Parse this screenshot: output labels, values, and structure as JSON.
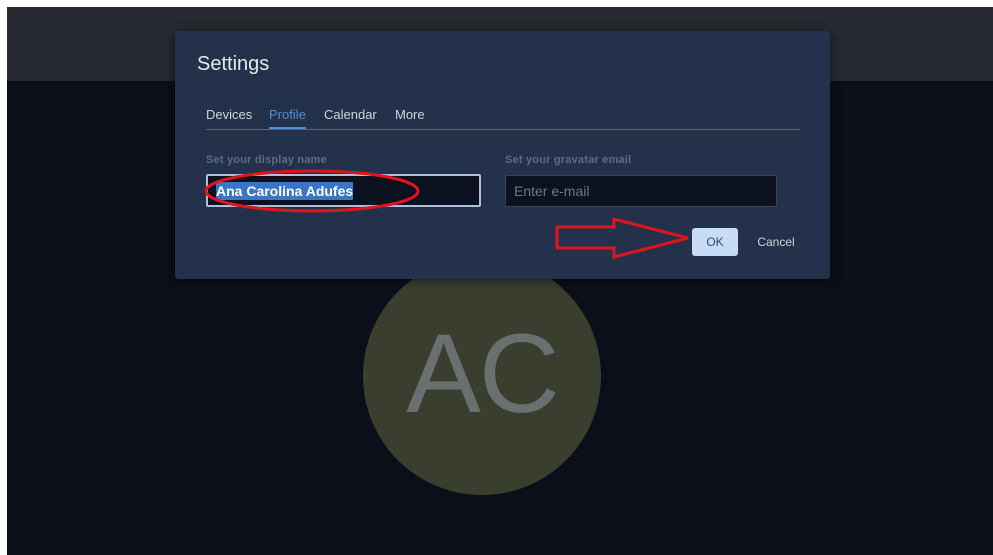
{
  "avatar": {
    "initials": "AC"
  },
  "dialog": {
    "title": "Settings",
    "tabs": [
      {
        "label": "Devices",
        "active": false
      },
      {
        "label": "Profile",
        "active": true
      },
      {
        "label": "Calendar",
        "active": false
      },
      {
        "label": "More",
        "active": false
      }
    ],
    "display_name": {
      "label": "Set your display name",
      "value": "Ana Carolina Adufes"
    },
    "gravatar": {
      "label": "Set your gravatar email",
      "placeholder": "Enter e-mail"
    },
    "ok_label": "OK",
    "cancel_label": "Cancel"
  },
  "colors": {
    "background": "#0b0f19",
    "topbar": "#262a30",
    "dialog": "#24314a",
    "accent": "#4e8fd8",
    "selection": "#3a76c8",
    "ok_button": "#c8dbf6",
    "annotation": "#e0141e",
    "avatar": "#3a3e2e"
  },
  "annotations": [
    {
      "type": "ellipse",
      "target": "display-name-input",
      "color": "#e0141e"
    },
    {
      "type": "arrow",
      "target": "ok-button",
      "color": "#e0141e"
    }
  ]
}
